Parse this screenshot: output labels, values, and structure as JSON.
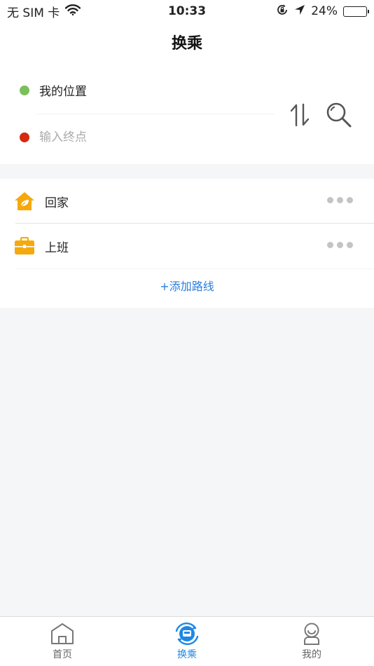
{
  "status_bar": {
    "carrier": "无 SIM 卡",
    "time": "10:33",
    "battery": "24%",
    "battery_level": 0.24
  },
  "nav": {
    "title": "换乘"
  },
  "route": {
    "from_label": "我的位置",
    "to_placeholder": "输入终点",
    "from_color": "#7ac05a",
    "to_color": "#d6290f"
  },
  "saved_routes": {
    "home_label": "回家",
    "work_label": "上班",
    "add_label": "+添加路线"
  },
  "tabs": [
    {
      "label": "首页",
      "icon": "home-icon",
      "active": false
    },
    {
      "label": "换乘",
      "icon": "transfer-icon",
      "active": true
    },
    {
      "label": "我的",
      "icon": "user-icon",
      "active": false
    }
  ],
  "colors": {
    "accent": "#1e88e5",
    "link": "#2a7de1",
    "icon_orange": "#f5a90d"
  }
}
